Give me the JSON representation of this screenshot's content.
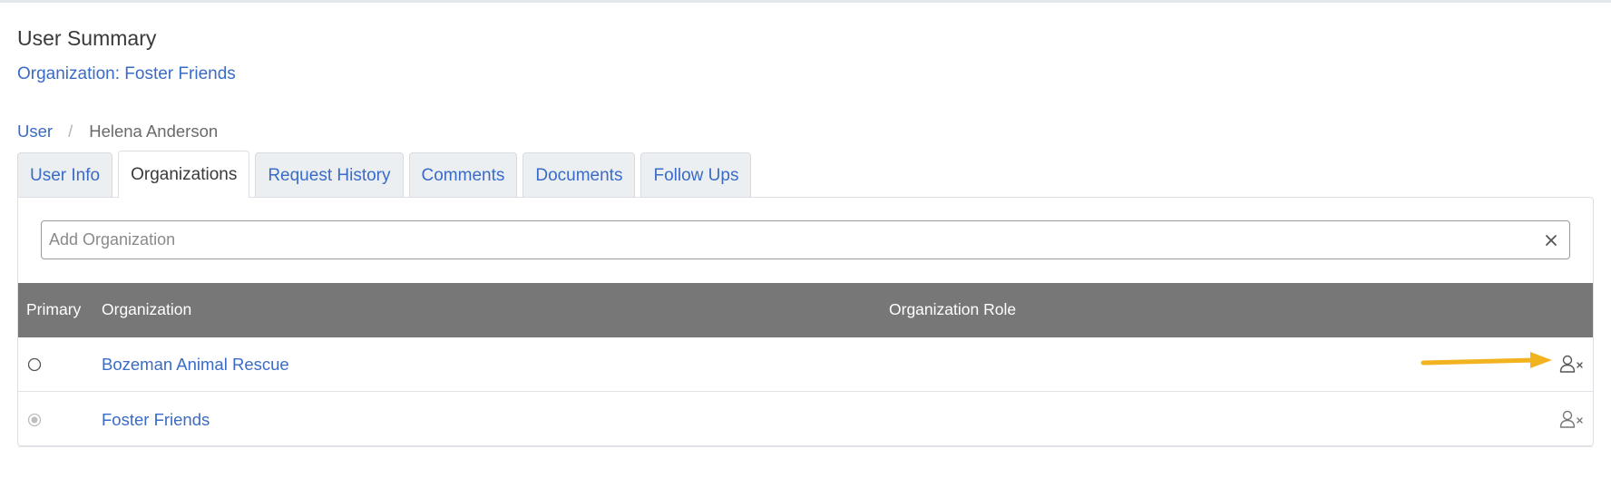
{
  "header": {
    "title": "User Summary",
    "organization_link": "Organization: Foster Friends"
  },
  "breadcrumb": {
    "parent": "User",
    "separator": "/",
    "current": "Helena Anderson"
  },
  "tabs": [
    {
      "label": "User Info",
      "active": false
    },
    {
      "label": "Organizations",
      "active": true
    },
    {
      "label": "Request History",
      "active": false
    },
    {
      "label": "Comments",
      "active": false
    },
    {
      "label": "Documents",
      "active": false
    },
    {
      "label": "Follow Ups",
      "active": false
    }
  ],
  "add_organization": {
    "placeholder": "Add Organization",
    "value": "",
    "clear_icon": "close-icon"
  },
  "table": {
    "columns": [
      "Primary",
      "Organization",
      "Organization Role"
    ],
    "rows": [
      {
        "primary": false,
        "organization": "Bozeman Animal Rescue",
        "role": "",
        "action_icon": "remove-user-icon"
      },
      {
        "primary": true,
        "organization": "Foster Friends",
        "role": "",
        "action_icon": "remove-user-icon"
      }
    ]
  },
  "annotation": {
    "arrow_color": "#f2b320"
  },
  "colors": {
    "link": "#3a6bc6",
    "table_header_bg": "#777777",
    "tab_bg": "#eceff1"
  }
}
